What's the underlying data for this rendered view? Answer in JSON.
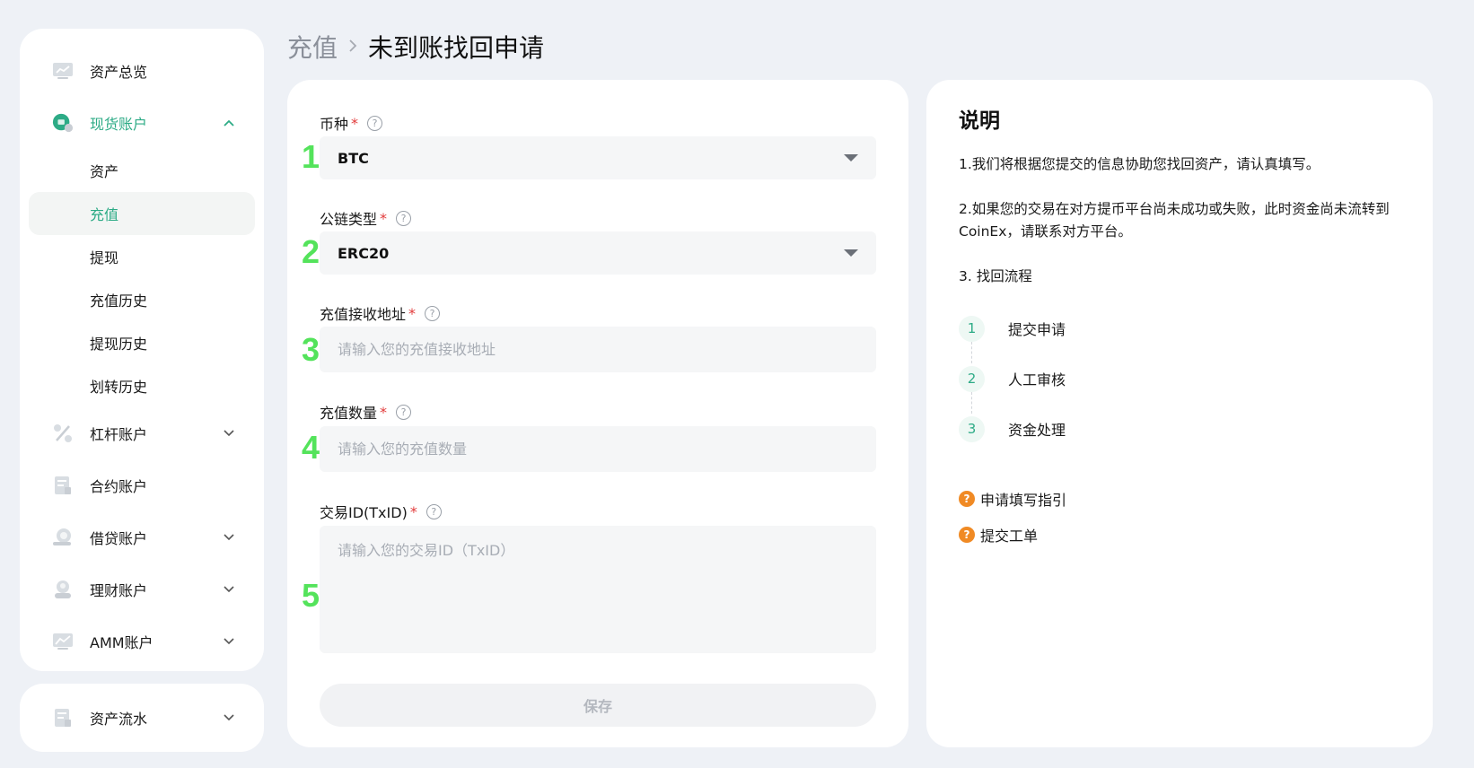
{
  "sidebar": {
    "overview": {
      "label": "资产总览",
      "icon": "chart-board-icon"
    },
    "spot": {
      "label": "现货账户",
      "icon": "spot-coin-icon",
      "expanded": true,
      "sub_items": [
        {
          "label": "资产"
        },
        {
          "label": "充值",
          "active": true
        },
        {
          "label": "提现"
        },
        {
          "label": "充值历史"
        },
        {
          "label": "提现历史"
        },
        {
          "label": "划转历史"
        }
      ]
    },
    "margin": {
      "label": "杠杆账户",
      "icon": "percent-icon"
    },
    "futures": {
      "label": "合约账户",
      "icon": "contract-doc-icon"
    },
    "loan": {
      "label": "借贷账户",
      "icon": "loan-coin-icon"
    },
    "finance": {
      "label": "理财账户",
      "icon": "finance-user-icon"
    },
    "amm": {
      "label": "AMM账户",
      "icon": "amm-chart-icon"
    },
    "flow": {
      "label": "资产流水",
      "icon": "ledger-icon"
    }
  },
  "breadcrumb": {
    "parent": "充值",
    "current": "未到账找回申请"
  },
  "form": {
    "coin": {
      "step": "1",
      "label": "币种",
      "value": "BTC"
    },
    "chain": {
      "step": "2",
      "label": "公链类型",
      "value": "ERC20"
    },
    "address": {
      "step": "3",
      "label": "充值接收地址",
      "placeholder": "请输入您的充值接收地址"
    },
    "amount": {
      "step": "4",
      "label": "充值数量",
      "placeholder": "请输入您的充值数量"
    },
    "txid": {
      "step": "5",
      "label": "交易ID(TxID)",
      "placeholder": "请输入您的交易ID（TxID）"
    },
    "required_mark": "*",
    "help_glyph": "?",
    "save_label": "保存"
  },
  "info": {
    "title": "说明",
    "para1": "1.我们将根据您提交的信息协助您找回资产，请认真填写。",
    "para2": "2.如果您的交易在对方提币平台尚未成功或失败，此时资金尚未流转到CoinEx，请联系对方平台。",
    "para3": "3. 找回流程",
    "steps": [
      {
        "num": "1",
        "label": "提交申请"
      },
      {
        "num": "2",
        "label": "人工审核"
      },
      {
        "num": "3",
        "label": "资金处理"
      }
    ],
    "links": [
      {
        "label": "申请填写指引"
      },
      {
        "label": "提交工单"
      }
    ]
  },
  "colors": {
    "accent": "#2dab86",
    "step_marker": "#54e35b",
    "required": "#e23a3a",
    "link_icon": "#f08a24"
  }
}
